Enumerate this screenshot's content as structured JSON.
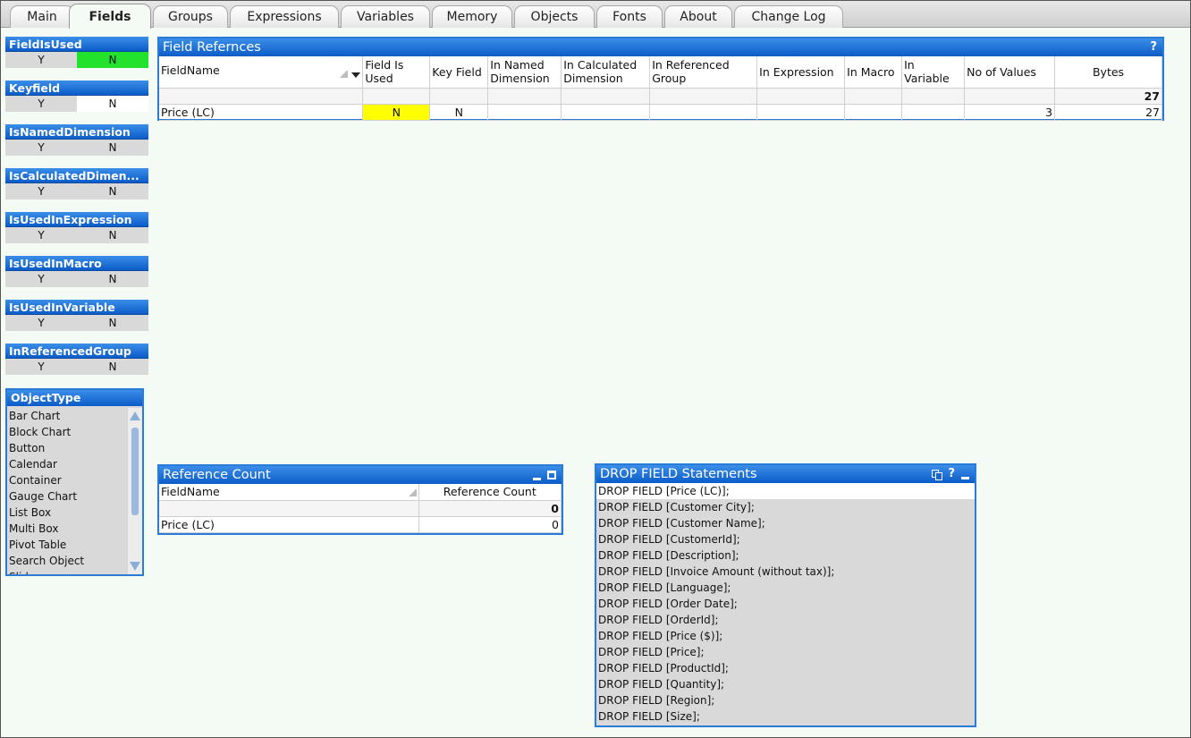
{
  "tabs": [
    "Main",
    "Fields",
    "Groups",
    "Expressions",
    "Variables",
    "Memory",
    "Objects",
    "Fonts",
    "About",
    "Change Log"
  ],
  "active_tab": "Fields",
  "listboxes": [
    {
      "title": "FieldIsUsed",
      "y": "Y",
      "n": "N"
    },
    {
      "title": "Keyfield",
      "y": "Y",
      "n": "N"
    },
    {
      "title": "IsNamedDimension",
      "y": "Y",
      "n": "N"
    },
    {
      "title": "IsCalculatedDimen...",
      "y": "Y",
      "n": "N"
    },
    {
      "title": "IsUsedInExpression",
      "y": "Y",
      "n": "N"
    },
    {
      "title": "IsUsedInMacro",
      "y": "Y",
      "n": "N"
    },
    {
      "title": "IsUsedInVariable",
      "y": "Y",
      "n": "N"
    },
    {
      "title": "InReferencedGroup",
      "y": "Y",
      "n": "N"
    }
  ],
  "object_type": {
    "title": "ObjectType",
    "items": [
      "Bar Chart",
      "Block Chart",
      "Button",
      "Calendar",
      "Container",
      "Gauge Chart",
      "List Box",
      "Multi Box",
      "Pivot Table",
      "Search Object",
      "Slider"
    ]
  },
  "field_refs": {
    "title": "Field Refernces",
    "help": "?",
    "headers": [
      "FieldName",
      "Field Is Used",
      "Key Field",
      "In Named Dimension",
      "In Calculated Dimension",
      "In Referenced Group",
      "In Expression",
      "In Macro",
      "In Variable",
      "No of Values",
      "Bytes"
    ],
    "total_bytes": "27",
    "row": [
      "Price (LC)",
      "N",
      "N",
      "",
      "",
      "",
      "",
      "",
      "",
      "3",
      "27"
    ]
  },
  "ref_count": {
    "title": "Reference Count",
    "headers": [
      "FieldName",
      "Reference Count"
    ],
    "total": "0",
    "row": [
      "Price (LC)",
      "0"
    ]
  },
  "drop": {
    "title": "DROP FIELD Statements",
    "help": "?",
    "items": [
      "DROP FIELD [Price (LC)];",
      "DROP FIELD [Customer City];",
      "DROP FIELD [Customer Name];",
      "DROP FIELD [CustomerId];",
      "DROP FIELD [Description];",
      "DROP FIELD [Invoice Amount (without tax)];",
      "DROP FIELD [Language];",
      "DROP FIELD [Order Date];",
      "DROP FIELD [OrderId];",
      "DROP FIELD [Price ($)];",
      "DROP FIELD [Price];",
      "DROP FIELD [ProductId];",
      "DROP FIELD [Quantity];",
      "DROP FIELD [Region];",
      "DROP FIELD [Size];"
    ]
  }
}
